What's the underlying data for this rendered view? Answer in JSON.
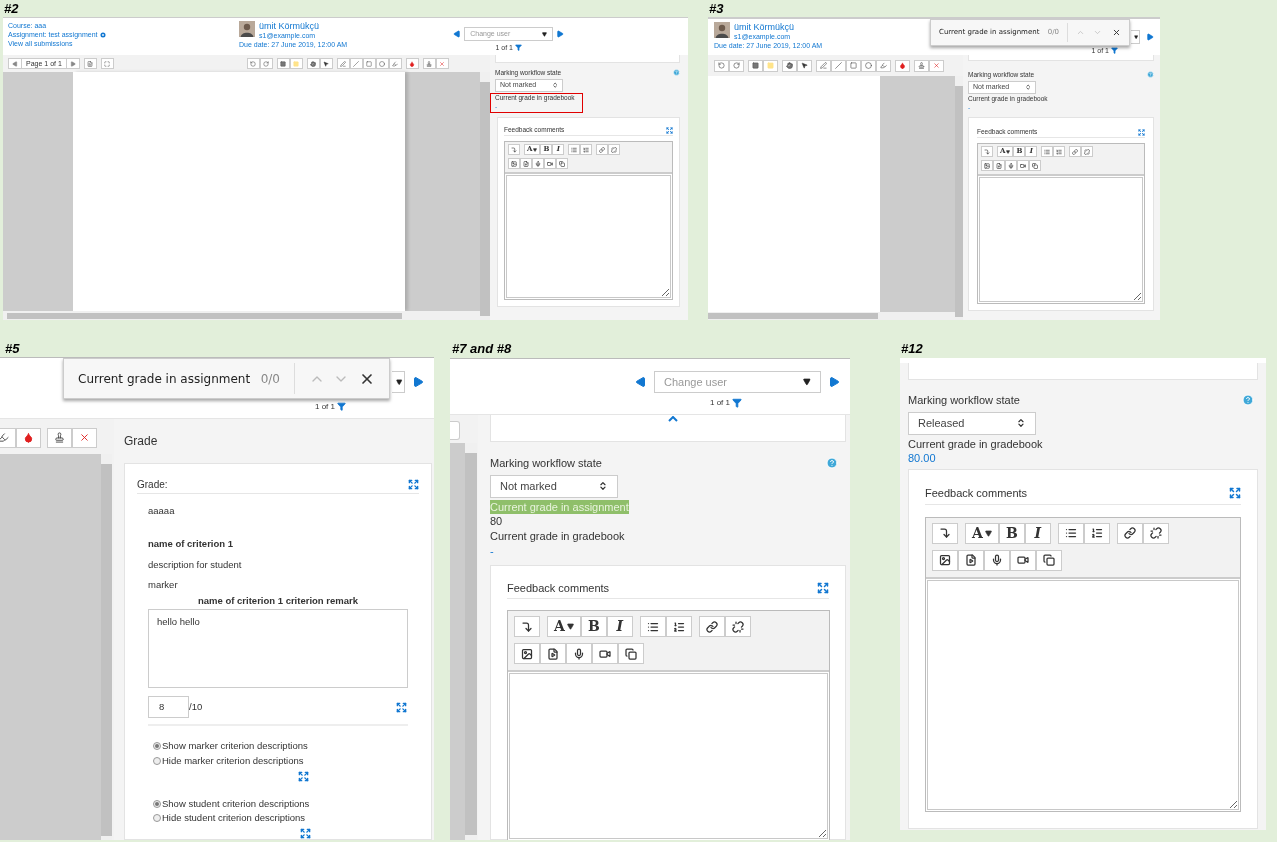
{
  "shot_2": {
    "label": "#2",
    "course": "Course: aaa",
    "assignment": "Assignment: test assignment",
    "view_all": "View all submissions",
    "user_name": "ümit Körmükçü",
    "email": "s1@example.com",
    "due_date": "Due date: 27 June 2019, 12:00 AM",
    "change_user": "Change user",
    "count": "1 of 1",
    "pager": "Page 1 of 1",
    "side": {
      "workflow_label": "Marking workflow state",
      "workflow_value": "Not marked",
      "grade_block": {
        "outlined": true,
        "rows": [
          {
            "kind": "label",
            "text": "Current grade in gradebook",
            "highlighted": false
          },
          {
            "kind": "link",
            "text": "-",
            "highlighted": false
          }
        ]
      },
      "feedback": {
        "title": "Feedback comments",
        "font": "A",
        "bold": "B",
        "italic": "I"
      }
    }
  },
  "shot_3": {
    "label": "#3",
    "user_name": "ümit Körmükçü",
    "email": "s1@example.com",
    "due_date": "Due date: 27 June 2019, 12:00 AM",
    "find": {
      "query": "Current grade in assignment",
      "matches": "0/0"
    },
    "count": "1 of 1",
    "side": {
      "workflow_label": "Marking workflow state",
      "workflow_value": "Not marked",
      "grade_block": {
        "outlined": false,
        "rows": [
          {
            "kind": "label",
            "text": "Current grade in gradebook",
            "highlighted": false
          },
          {
            "kind": "link",
            "text": "-",
            "highlighted": false
          }
        ]
      },
      "feedback": {
        "title": "Feedback comments",
        "font": "A",
        "bold": "B",
        "italic": "I"
      }
    }
  },
  "shot_5": {
    "label": "#5",
    "find": {
      "query": "Current grade in assignment",
      "matches": "0/0"
    },
    "count": "1 of 1",
    "heading": "Grade",
    "grade_title": "Grade:",
    "rubric": {
      "description": "aaaaa",
      "criterion": "name of criterion 1",
      "student_description": "description for student",
      "marker": "marker",
      "remark_title": "name of criterion 1 criterion remark",
      "remark": "hello hello",
      "score": "8",
      "max": "/10"
    },
    "marker_options": [
      {
        "text": "Show marker criterion descriptions",
        "selected": true
      },
      {
        "text": "Hide marker criterion descriptions",
        "selected": false
      }
    ],
    "student_options": [
      {
        "text": "Show student criterion descriptions",
        "selected": true
      },
      {
        "text": "Hide student criterion descriptions",
        "selected": false
      }
    ]
  },
  "shot_7_8": {
    "label": "#7 and #8",
    "change_user": "Change user",
    "count": "1 of 1",
    "side": {
      "workflow_label": "Marking workflow state",
      "workflow_value": "Not marked",
      "grade_block": {
        "outlined": false,
        "rows": [
          {
            "kind": "label",
            "text": "Current grade in assignment",
            "highlighted": true
          },
          {
            "kind": "value",
            "text": "80",
            "highlighted": false
          },
          {
            "kind": "label",
            "text": "Current grade in gradebook",
            "highlighted": false
          },
          {
            "kind": "link",
            "text": "-",
            "highlighted": false
          }
        ]
      },
      "feedback": {
        "title": "Feedback comments",
        "font": "A",
        "bold": "B",
        "italic": "I"
      }
    }
  },
  "shot_12": {
    "label": "#12",
    "side": {
      "workflow_label": "Marking workflow state",
      "workflow_value": "Released",
      "grade_block": {
        "outlined": false,
        "rows": [
          {
            "kind": "label",
            "text": "Current grade in gradebook",
            "highlighted": false
          },
          {
            "kind": "link",
            "text": "80.00",
            "highlighted": false
          }
        ]
      },
      "feedback": {
        "title": "Feedback comments",
        "font": "A",
        "bold": "B",
        "italic": "I"
      }
    }
  }
}
